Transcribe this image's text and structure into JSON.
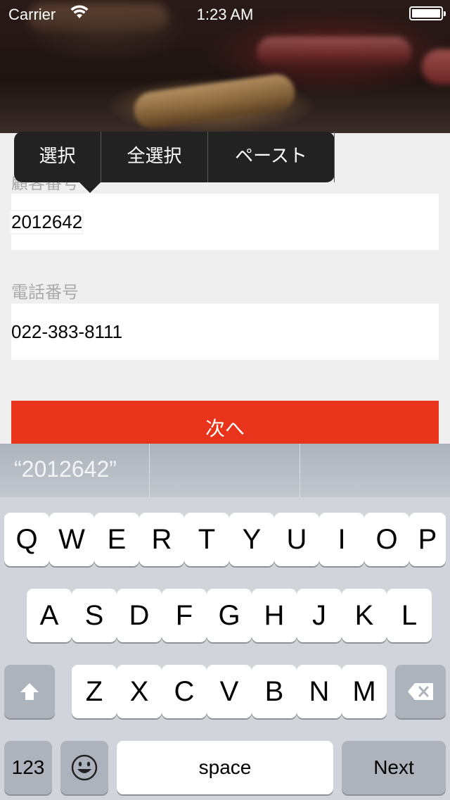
{
  "status_bar": {
    "carrier": "Carrier",
    "time": "1:23 AM"
  },
  "form": {
    "customer_label": "顧客番号",
    "customer_value": "2012642",
    "phone_label": "電話番号",
    "phone_value": "022-383-8111",
    "next_label": "次へ"
  },
  "edit_menu": {
    "items": [
      "選択",
      "全選択",
      "ペースト"
    ]
  },
  "keyboard": {
    "prediction": "“2012642”",
    "row1": [
      "Q",
      "W",
      "E",
      "R",
      "T",
      "Y",
      "U",
      "I",
      "O",
      "P"
    ],
    "row2": [
      "A",
      "S",
      "D",
      "F",
      "G",
      "H",
      "J",
      "K",
      "L"
    ],
    "row3": [
      "Z",
      "X",
      "C",
      "V",
      "B",
      "N",
      "M"
    ],
    "numbers_label": "123",
    "space_label": "space",
    "return_label": "Next",
    "shift_icon": "shift-arrow-icon",
    "delete_icon": "backspace-icon",
    "emoji_icon": "emoji-face-icon"
  },
  "colors": {
    "accent": "#e8341a",
    "menu_bg": "#222222",
    "keyboard_bg": "#d1d5db"
  }
}
